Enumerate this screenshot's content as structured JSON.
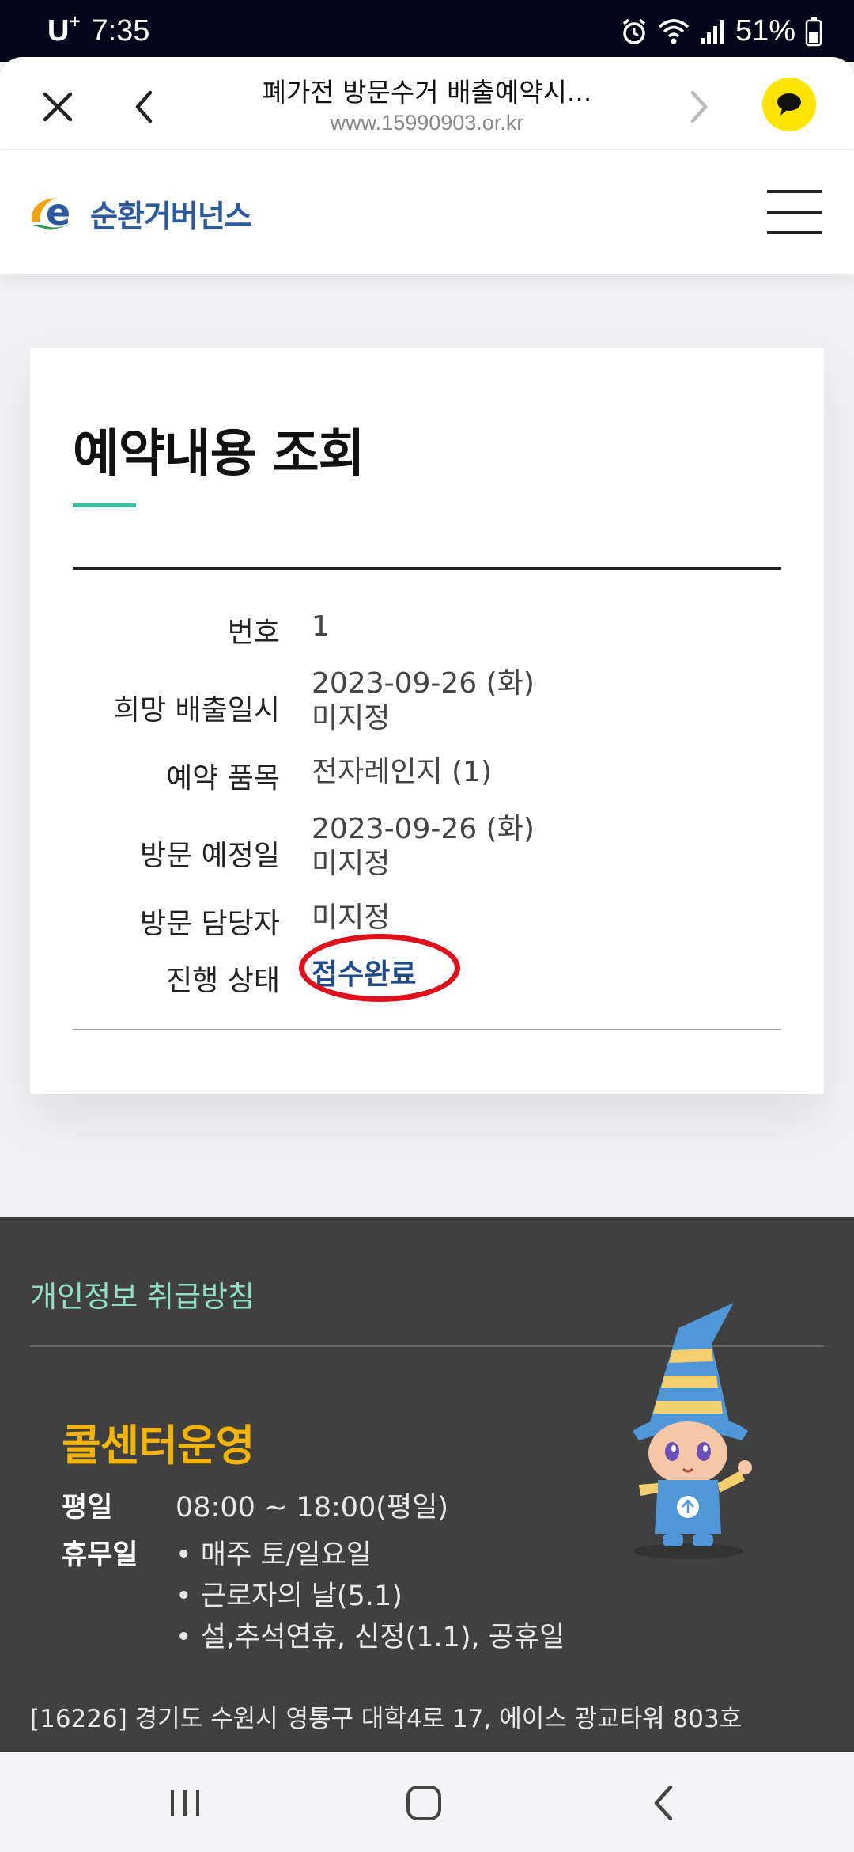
{
  "status_bar": {
    "carrier": "U",
    "carrier_plus": "+",
    "time": "7:35",
    "battery": "51%"
  },
  "browser": {
    "title": "폐가전 방문수거 배출예약시...",
    "url": "www.15990903.or.kr",
    "icons": [
      "close-icon",
      "back-icon",
      "forward-icon",
      "kakaotalk-icon"
    ]
  },
  "site": {
    "logo_text": "순환거버넌스",
    "logo_mark": "e"
  },
  "reservation": {
    "title": "예약내용 조회",
    "rows": [
      {
        "label": "번호",
        "value": "1"
      },
      {
        "label": "희망 배출일시",
        "value": "2023-09-26 (화)",
        "value2": "미지정"
      },
      {
        "label": "예약 품목",
        "value": "전자레인지 (1)"
      },
      {
        "label": "방문 예정일",
        "value": "2023-09-26 (화)",
        "value2": "미지정"
      },
      {
        "label": "방문 담당자",
        "value": "미지정"
      },
      {
        "label": "진행 상태",
        "value": "접수완료"
      }
    ],
    "status_color": "#1f4a8c",
    "highlight_color": "#e0101a"
  },
  "footer": {
    "privacy_link": "개인정보 취급방침",
    "call_center_title": "콜센터운영",
    "weekday_label": "평일",
    "weekday_hours": "08:00 ~ 18:00(평일)",
    "holiday_label": "휴무일",
    "holidays": [
      "• 매주 토/일요일",
      "• 근로자의 날(5.1)",
      "• 설,추석연휴, 신정(1.1), 공휴일"
    ],
    "address": "[16226] 경기도 수원시 영통구 대학4로 17, 에이스 광교타워 803호"
  },
  "nav": {
    "icons": [
      "recent-apps-icon",
      "home-icon",
      "back-nav-icon"
    ]
  }
}
